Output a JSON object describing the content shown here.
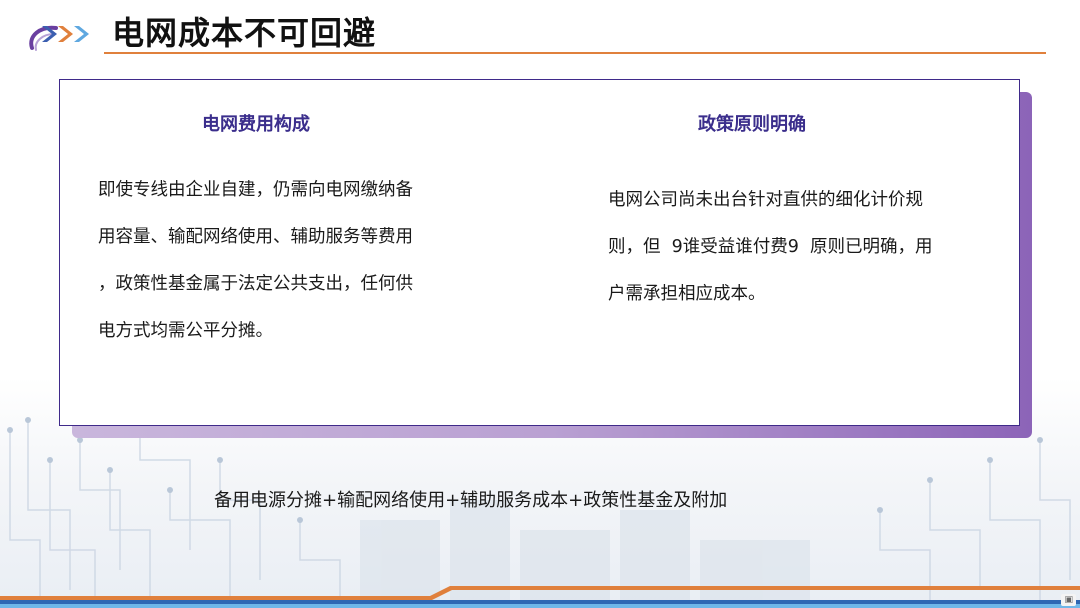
{
  "header": {
    "title": "电网成本不可回避"
  },
  "card": {
    "left": {
      "heading": "电网费用构成",
      "lines": [
        "即使专线由企业自建，仍需向电网缴纳备",
        "用容量、输配网络使用、辅助服务等费用",
        "，政策性基金属于法定公共支出，任何供",
        "电方式均需公平分摊。"
      ]
    },
    "right": {
      "heading": "政策原则明确",
      "lines": [
        "电网公司尚未出台针对直供的细化计价规",
        "则，但  9谁受益谁付费9  原则已明确，用",
        "户需承担相应成本。"
      ]
    }
  },
  "summary": "备用电源分摊+输配网络使用+辅助服务成本+政策性基金及附加",
  "colors": {
    "accent_orange": "#e0803c",
    "heading_purple": "#3b2e8c",
    "card_border": "#3f2a8a",
    "shadow_purple": "#8c64b8"
  }
}
